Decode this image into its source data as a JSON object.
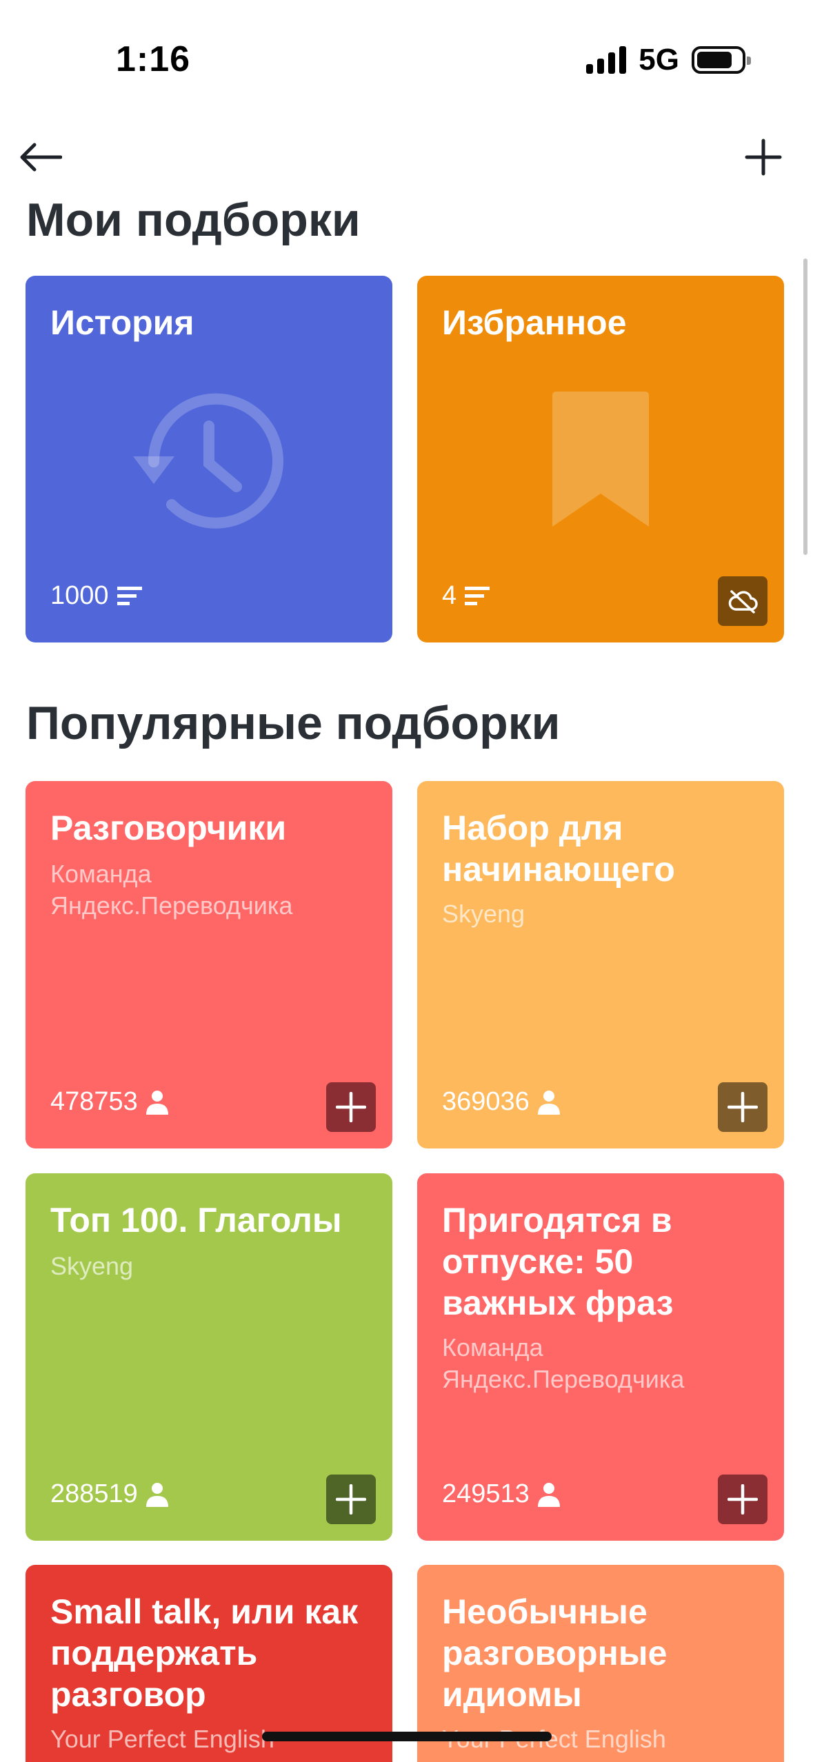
{
  "status_bar": {
    "time": "1:16",
    "network": "5G"
  },
  "sections": {
    "mine_title": "Мои подборки",
    "popular_title": "Популярные подборки"
  },
  "my_collections": [
    {
      "title": "История",
      "count": "1000",
      "color": "#5066d9",
      "illustration": "history-icon"
    },
    {
      "title": "Избранное",
      "count": "4",
      "color": "#ef8d0a",
      "illustration": "bookmark-icon",
      "action": "cloud-off-icon"
    }
  ],
  "popular_collections": [
    {
      "title": "Разговорчики",
      "author": "Команда Яндекс.Переводчика",
      "subscribers": "478753",
      "color": "#ff6666",
      "button_color": "#8a2e33"
    },
    {
      "title": "Набор для начинающего",
      "author": "Skyeng",
      "subscribers": "369036",
      "color": "#fdb95c",
      "button_color": "#7f5c2c"
    },
    {
      "title": "Топ 100. Глаголы",
      "author": "Skyeng",
      "subscribers": "288519",
      "color": "#a4c84c",
      "button_color": "#4e6527"
    },
    {
      "title": "Пригодятся в отпуске: 50 важных фраз",
      "author": "Команда Яндекс.Переводчика",
      "subscribers": "249513",
      "color": "#ff6666",
      "button_color": "#8a2e33"
    },
    {
      "title": "Small talk, или как поддержать разговор",
      "author": "Your Perfect English",
      "color": "#e53b32"
    },
    {
      "title": "Необычные разговорные идиомы",
      "author": "Your Perfect English",
      "color": "#ff9163"
    }
  ]
}
